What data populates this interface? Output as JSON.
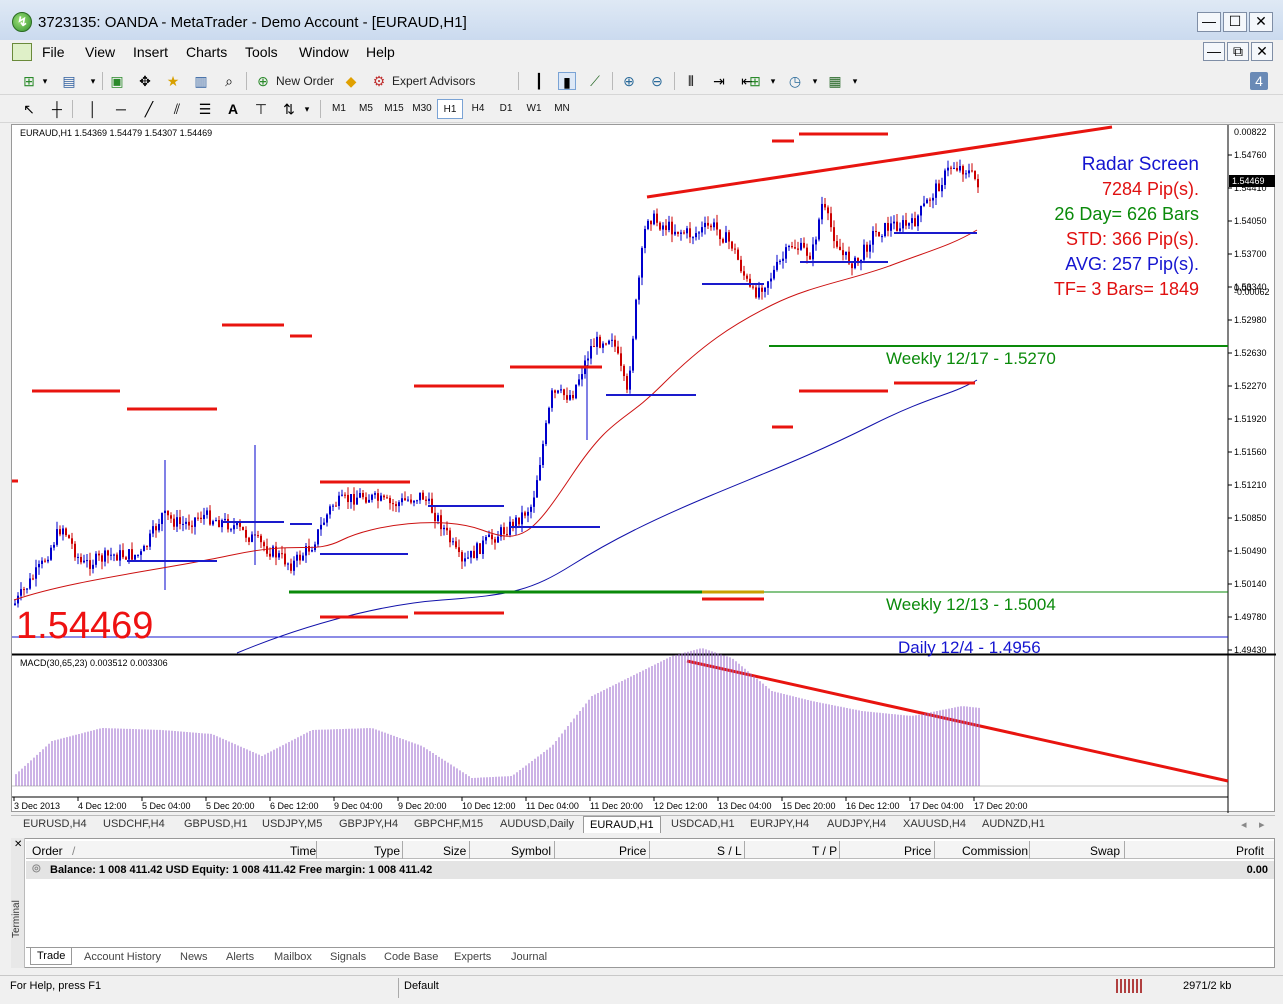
{
  "window": {
    "title": "3723135: OANDA - MetaTrader - Demo Account - [EURAUD,H1]",
    "min_glyph": "—",
    "max_glyph": "☐",
    "close_glyph": "✕",
    "restore_glyph": "⧉"
  },
  "menu": [
    "File",
    "View",
    "Insert",
    "Charts",
    "Tools",
    "Window",
    "Help"
  ],
  "toolbar": {
    "new_order": "New Order",
    "expert_advisors": "Expert Advisors",
    "text_tool": "A",
    "timeframes": [
      "M1",
      "M5",
      "M15",
      "M30",
      "H1",
      "H4",
      "D1",
      "W1",
      "MN"
    ],
    "active_timeframe": "H1"
  },
  "chart": {
    "header": "EURAUD,H1  1.54369 1.54479 1.54307 1.54469",
    "big_price": "1.54469",
    "current_price_label": "1.54469",
    "price_ticks": [
      "1.54760",
      "1.54410",
      "1.54050",
      "1.53700",
      "1.53340",
      "1.52980",
      "1.52630",
      "1.52270",
      "1.51920",
      "1.51560",
      "1.51210",
      "1.50850",
      "1.50490",
      "1.50140",
      "1.49780",
      "1.49430"
    ],
    "radar": {
      "title": "Radar Screen",
      "pips": "7284 Pip(s).",
      "day_bars": "26 Day= 626 Bars",
      "std": "STD: 366 Pip(s).",
      "avg": "AVG: 257 Pip(s).",
      "tf": "TF= 3 Bars= 1849"
    },
    "levels": {
      "weekly_1217": "Weekly 12/17 - 1.5270",
      "weekly_1213": "Weekly 12/13 - 1.5004",
      "daily_124": "Daily 12/4 - 1.4956"
    },
    "macd_header": "MACD(30,65,23) 0.003512 0.003306",
    "macd_ticks": [
      "0.00822",
      "0.00",
      "-0.00062"
    ],
    "time_ticks": [
      "3 Dec 2013",
      "4 Dec 12:00",
      "5 Dec 04:00",
      "5 Dec 20:00",
      "6 Dec 12:00",
      "9 Dec 04:00",
      "9 Dec 20:00",
      "10 Dec 12:00",
      "11 Dec 04:00",
      "11 Dec 20:00",
      "12 Dec 12:00",
      "13 Dec 04:00",
      "15 Dec 20:00",
      "16 Dec 12:00",
      "17 Dec 04:00",
      "17 Dec 20:00"
    ],
    "colors": {
      "bull": "#0000cc",
      "bear": "#cc0000",
      "red_line": "#e8140f",
      "blue_line": "#1a1acc",
      "green_line": "#0a8a0a",
      "macd": "#9966cc"
    }
  },
  "symbol_tabs": [
    "EURUSD,H4",
    "USDCHF,H4",
    "GBPUSD,H1",
    "USDJPY,M5",
    "GBPJPY,H4",
    "GBPCHF,M15",
    "AUDUSD,Daily",
    "EURAUD,H1",
    "USDCAD,H1",
    "EURJPY,H4",
    "AUDJPY,H4",
    "XAUUSD,H4",
    "AUDNZD,H1"
  ],
  "active_symbol": "EURAUD,H1",
  "terminal": {
    "side_label": "Terminal",
    "columns": [
      "Order",
      "/",
      "Time",
      "Type",
      "Size",
      "Symbol",
      "Price",
      "S / L",
      "T / P",
      "Price",
      "Commission",
      "Swap",
      "Profit"
    ],
    "balance_line": "Balance: 1 008 411.42 USD  Equity: 1 008 411.42  Free margin: 1 008 411.42",
    "profit": "0.00",
    "tabs": [
      "Trade",
      "Account History",
      "News",
      "Alerts",
      "Mailbox",
      "Signals",
      "Code Base",
      "Experts",
      "Journal"
    ],
    "active_tab": "Trade"
  },
  "status": {
    "help": "For Help, press F1",
    "profile": "Default",
    "traffic": "2971/2 kb"
  }
}
